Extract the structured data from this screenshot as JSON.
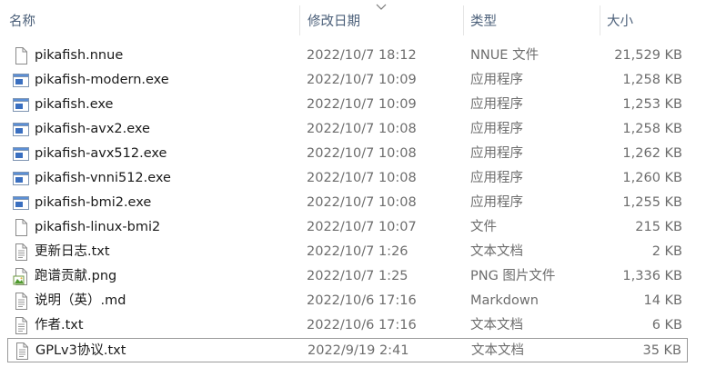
{
  "columns": {
    "name": "名称",
    "date": "修改日期",
    "type": "类型",
    "size": "大小"
  },
  "files": [
    {
      "name": "pikafish.nnue",
      "date": "2022/10/7 18:12",
      "type": "NNUE 文件",
      "size": "21,529 KB",
      "icon": "file-icon"
    },
    {
      "name": "pikafish-modern.exe",
      "date": "2022/10/7 10:09",
      "type": "应用程序",
      "size": "1,258 KB",
      "icon": "exe-icon"
    },
    {
      "name": "pikafish.exe",
      "date": "2022/10/7 10:09",
      "type": "应用程序",
      "size": "1,253 KB",
      "icon": "exe-icon"
    },
    {
      "name": "pikafish-avx2.exe",
      "date": "2022/10/7 10:08",
      "type": "应用程序",
      "size": "1,258 KB",
      "icon": "exe-icon"
    },
    {
      "name": "pikafish-avx512.exe",
      "date": "2022/10/7 10:08",
      "type": "应用程序",
      "size": "1,262 KB",
      "icon": "exe-icon"
    },
    {
      "name": "pikafish-vnni512.exe",
      "date": "2022/10/7 10:08",
      "type": "应用程序",
      "size": "1,260 KB",
      "icon": "exe-icon"
    },
    {
      "name": "pikafish-bmi2.exe",
      "date": "2022/10/7 10:08",
      "type": "应用程序",
      "size": "1,255 KB",
      "icon": "exe-icon"
    },
    {
      "name": "pikafish-linux-bmi2",
      "date": "2022/10/7 10:07",
      "type": "文件",
      "size": "215 KB",
      "icon": "file-icon"
    },
    {
      "name": "更新日志.txt",
      "date": "2022/10/7 1:26",
      "type": "文本文档",
      "size": "2 KB",
      "icon": "text-file-icon"
    },
    {
      "name": "跑谱贡献.png",
      "date": "2022/10/7 1:25",
      "type": "PNG 图片文件",
      "size": "1,336 KB",
      "icon": "image-file-icon"
    },
    {
      "name": "说明（英）.md",
      "date": "2022/10/6 17:16",
      "type": "Markdown",
      "size": "14 KB",
      "icon": "text-file-icon"
    },
    {
      "name": "作者.txt",
      "date": "2022/10/6 17:16",
      "type": "文本文档",
      "size": "6 KB",
      "icon": "text-file-icon"
    },
    {
      "name": "GPLv3协议.txt",
      "date": "2022/9/19 2:41",
      "type": "文本文档",
      "size": "35 KB",
      "icon": "text-file-icon",
      "focused": true
    }
  ]
}
